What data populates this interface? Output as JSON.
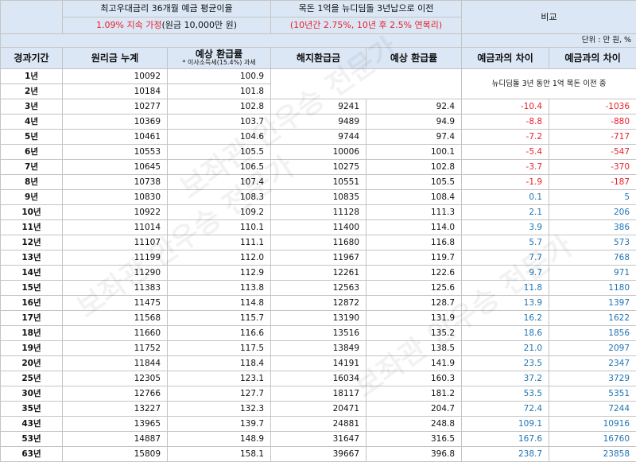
{
  "header": {
    "group1_title": "최고우대금리 36개월 예금 평균이율",
    "group1_sub": "1.09% 지속 가정",
    "group1_sub_black": "(원금 10,000만 원)",
    "group2_title": "목돈 1억을 뉴디딤돌 3년납으로 이전",
    "group2_sub": "(10년간 2.75%, 10년 후 2.5% 연복리)",
    "group3_title": "비교",
    "unit": "단위 : 만 원, %",
    "col_period": "경과기간",
    "col_sum": "원리금 누계",
    "col_rate": "예상 환급률",
    "col_tax_note": "* 이사소득세(15.4%) 과세",
    "col_refund": "해지환급금",
    "col_rate2": "예상 환급률",
    "col_diff_rate": "예금과의 차이",
    "col_diff_amount": "예금과의 차이",
    "note": "뉴디딤돌 3년 동안 1억 목돈 이전 중"
  },
  "rows": [
    {
      "period": "1년",
      "sum": "10092",
      "rate": "100.9",
      "refund": "",
      "rate2": "",
      "diff_rate": "",
      "diff_amt": ""
    },
    {
      "period": "2년",
      "sum": "10184",
      "rate": "101.8",
      "refund": "",
      "rate2": "",
      "diff_rate": "",
      "diff_amt": ""
    },
    {
      "period": "3년",
      "sum": "10277",
      "rate": "102.8",
      "refund": "9241",
      "rate2": "92.4",
      "diff_rate": "-10.4",
      "diff_amt": "-1036"
    },
    {
      "period": "4년",
      "sum": "10369",
      "rate": "103.7",
      "refund": "9489",
      "rate2": "94.9",
      "diff_rate": "-8.8",
      "diff_amt": "-880"
    },
    {
      "period": "5년",
      "sum": "10461",
      "rate": "104.6",
      "refund": "9744",
      "rate2": "97.4",
      "diff_rate": "-7.2",
      "diff_amt": "-717"
    },
    {
      "period": "6년",
      "sum": "10553",
      "rate": "105.5",
      "refund": "10006",
      "rate2": "100.1",
      "diff_rate": "-5.4",
      "diff_amt": "-547"
    },
    {
      "period": "7년",
      "sum": "10645",
      "rate": "106.5",
      "refund": "10275",
      "rate2": "102.8",
      "diff_rate": "-3.7",
      "diff_amt": "-370"
    },
    {
      "period": "8년",
      "sum": "10738",
      "rate": "107.4",
      "refund": "10551",
      "rate2": "105.5",
      "diff_rate": "-1.9",
      "diff_amt": "-187"
    },
    {
      "period": "9년",
      "sum": "10830",
      "rate": "108.3",
      "refund": "10835",
      "rate2": "108.4",
      "diff_rate": "0.1",
      "diff_amt": "5"
    },
    {
      "period": "10년",
      "sum": "10922",
      "rate": "109.2",
      "refund": "11128",
      "rate2": "111.3",
      "diff_rate": "2.1",
      "diff_amt": "206"
    },
    {
      "period": "11년",
      "sum": "11014",
      "rate": "110.1",
      "refund": "11400",
      "rate2": "114.0",
      "diff_rate": "3.9",
      "diff_amt": "386"
    },
    {
      "period": "12년",
      "sum": "11107",
      "rate": "111.1",
      "refund": "11680",
      "rate2": "116.8",
      "diff_rate": "5.7",
      "diff_amt": "573"
    },
    {
      "period": "13년",
      "sum": "11199",
      "rate": "112.0",
      "refund": "11967",
      "rate2": "119.7",
      "diff_rate": "7.7",
      "diff_amt": "768"
    },
    {
      "period": "14년",
      "sum": "11290",
      "rate": "112.9",
      "refund": "12261",
      "rate2": "122.6",
      "diff_rate": "9.7",
      "diff_amt": "971"
    },
    {
      "period": "15년",
      "sum": "11383",
      "rate": "113.8",
      "refund": "12563",
      "rate2": "125.6",
      "diff_rate": "11.8",
      "diff_amt": "1180"
    },
    {
      "period": "16년",
      "sum": "11475",
      "rate": "114.8",
      "refund": "12872",
      "rate2": "128.7",
      "diff_rate": "13.9",
      "diff_amt": "1397"
    },
    {
      "period": "17년",
      "sum": "11568",
      "rate": "115.7",
      "refund": "13190",
      "rate2": "131.9",
      "diff_rate": "16.2",
      "diff_amt": "1622"
    },
    {
      "period": "18년",
      "sum": "11660",
      "rate": "116.6",
      "refund": "13516",
      "rate2": "135.2",
      "diff_rate": "18.6",
      "diff_amt": "1856"
    },
    {
      "period": "19년",
      "sum": "11752",
      "rate": "117.5",
      "refund": "13849",
      "rate2": "138.5",
      "diff_rate": "21.0",
      "diff_amt": "2097"
    },
    {
      "period": "20년",
      "sum": "11844",
      "rate": "118.4",
      "refund": "14191",
      "rate2": "141.9",
      "diff_rate": "23.5",
      "diff_amt": "2347"
    },
    {
      "period": "25년",
      "sum": "12305",
      "rate": "123.1",
      "refund": "16034",
      "rate2": "160.3",
      "diff_rate": "37.2",
      "diff_amt": "3729"
    },
    {
      "period": "30년",
      "sum": "12766",
      "rate": "127.7",
      "refund": "18117",
      "rate2": "181.2",
      "diff_rate": "53.5",
      "diff_amt": "5351"
    },
    {
      "period": "35년",
      "sum": "13227",
      "rate": "132.3",
      "refund": "20471",
      "rate2": "204.7",
      "diff_rate": "72.4",
      "diff_amt": "7244"
    },
    {
      "period": "43년",
      "sum": "13965",
      "rate": "139.7",
      "refund": "24881",
      "rate2": "248.8",
      "diff_rate": "109.1",
      "diff_amt": "10916"
    },
    {
      "period": "53년",
      "sum": "14887",
      "rate": "148.9",
      "refund": "31647",
      "rate2": "316.5",
      "diff_rate": "167.6",
      "diff_amt": "16760"
    },
    {
      "period": "63년",
      "sum": "15809",
      "rate": "158.1",
      "refund": "39667",
      "rate2": "396.8",
      "diff_rate": "238.7",
      "diff_amt": "23858"
    }
  ],
  "watermark": "보좌관 안우승 전문가",
  "colors": {
    "header_bg": "#dbe7f5",
    "negative": "#e8202a",
    "positive": "#1f74b3",
    "grid": "#c4c4c4"
  }
}
